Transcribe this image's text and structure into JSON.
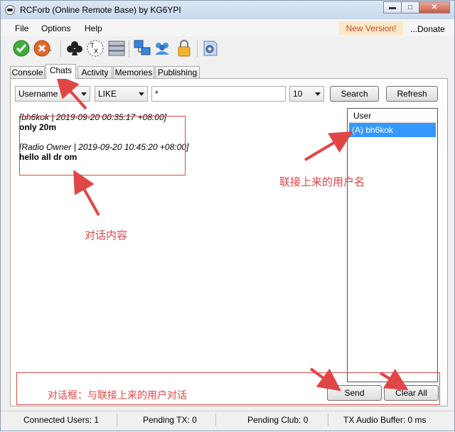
{
  "window": {
    "title": "RCForb (Online Remote Base) by KG6YPI"
  },
  "menu": {
    "items": [
      "File",
      "Options",
      "Help"
    ],
    "new_version": "New Version!",
    "donate": "...Donate"
  },
  "tabs": [
    "Console",
    "Chats",
    "Activity",
    "Memories",
    "Publishing"
  ],
  "filter": {
    "field": "Username",
    "operator": "LIKE",
    "value": "*",
    "limit": "10",
    "search_label": "Search",
    "refresh_label": "Refresh"
  },
  "chat_messages": [
    {
      "header": "[bh6kok | 2019-09-20 00:35:17 +08:00]",
      "text": "only 20m"
    },
    {
      "header": "[Radio Owner | 2019-09-20 10:45:20 +08:00]",
      "text": "hello all dr om"
    }
  ],
  "user_list": {
    "header": "User",
    "users": [
      "(A) bh6kok"
    ]
  },
  "input": {
    "send_label": "Send",
    "clear_label": "Clear All"
  },
  "annotations": {
    "chat_content": "对话内容",
    "connected_users": "联接上来的用户名",
    "dialog_box": "对话框：与联接上来的用户对话"
  },
  "status": {
    "connected_users": "Connected Users: 1",
    "pending_tx": "Pending TX: 0",
    "pending_club": "Pending Club: 0",
    "tx_audio_buffer": "TX Audio Buffer: 0 ms"
  },
  "colors": {
    "annotation": "#e04646",
    "selection": "#3399ff",
    "new_version": "#c04a2b"
  }
}
